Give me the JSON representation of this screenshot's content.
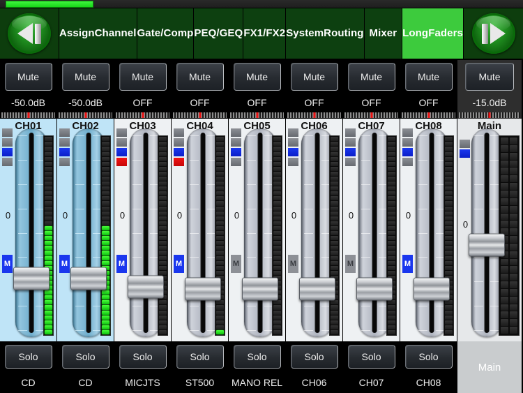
{
  "statusbar": {
    "led_color": "#2ee82e"
  },
  "header": {
    "prev_button": {
      "name": "previous-page",
      "icon": "prev-arrow-icon"
    },
    "next_button": {
      "name": "next-page",
      "icon": "next-arrow-icon"
    },
    "tabs": [
      {
        "label": "Assign\nChannel",
        "active": false
      },
      {
        "label": "Gate/Comp",
        "active": false
      },
      {
        "label": "PEQ/GEQ",
        "active": false
      },
      {
        "label": "FX1/FX2",
        "active": false
      },
      {
        "label": "System\nRouting",
        "active": false
      },
      {
        "label": "Mixer",
        "active": false
      },
      {
        "label": "Long\nFaders",
        "active": true
      }
    ],
    "active_tab_color": "#3dcb3d",
    "tab_color": "#0d4010"
  },
  "channels": [
    {
      "id": "CH01",
      "name": "CH01",
      "mute_label": "Mute",
      "level": "-50.0dB",
      "solo_label": "Solo",
      "bottom_label": "CD",
      "selected": true,
      "indicators": [
        "grey",
        "grey",
        "blue",
        "grey"
      ],
      "m_active": true,
      "zero_label": "0",
      "m_label": "M",
      "fader_pct": 72,
      "meter_segments": 40,
      "meter_lit": 22,
      "meter_gap_bottom": 0
    },
    {
      "id": "CH02",
      "name": "CH02",
      "mute_label": "Mute",
      "level": "-50.0dB",
      "solo_label": "Solo",
      "bottom_label": "CD",
      "selected": true,
      "indicators": [
        "grey",
        "grey",
        "blue",
        "grey"
      ],
      "m_active": true,
      "zero_label": "0",
      "m_label": "M",
      "fader_pct": 72,
      "meter_segments": 40,
      "meter_lit": 22,
      "meter_gap_bottom": 0
    },
    {
      "id": "CH03",
      "name": "CH03",
      "mute_label": "Mute",
      "level": "OFF",
      "solo_label": "Solo",
      "bottom_label": "MICJTS",
      "selected": false,
      "indicators": [
        "grey",
        "grey",
        "blue",
        "red"
      ],
      "m_active": true,
      "zero_label": "0",
      "m_label": "M",
      "fader_pct": 76,
      "meter_segments": 40,
      "meter_lit": 0,
      "meter_gap_bottom": 0
    },
    {
      "id": "CH04",
      "name": "CH04",
      "mute_label": "Mute",
      "level": "OFF",
      "solo_label": "Solo",
      "bottom_label": "ST500",
      "selected": false,
      "indicators": [
        "grey",
        "grey",
        "blue",
        "red"
      ],
      "m_active": true,
      "zero_label": "0",
      "m_label": "M",
      "fader_pct": 77,
      "meter_segments": 40,
      "meter_lit": 1,
      "meter_gap_bottom": 0
    },
    {
      "id": "CH05",
      "name": "CH05",
      "mute_label": "Mute",
      "level": "OFF",
      "solo_label": "Solo",
      "bottom_label": "MANO REL",
      "selected": false,
      "indicators": [
        "grey",
        "grey",
        "blue",
        "grey"
      ],
      "m_active": false,
      "zero_label": "0",
      "m_label": "M",
      "fader_pct": 77,
      "meter_segments": 40,
      "meter_lit": 0,
      "meter_gap_bottom": 0
    },
    {
      "id": "CH06",
      "name": "CH06",
      "mute_label": "Mute",
      "level": "OFF",
      "solo_label": "Solo",
      "bottom_label": "CH06",
      "selected": false,
      "indicators": [
        "grey",
        "grey",
        "blue",
        "grey"
      ],
      "m_active": false,
      "zero_label": "0",
      "m_label": "M",
      "fader_pct": 77,
      "meter_segments": 40,
      "meter_lit": 0,
      "meter_gap_bottom": 0
    },
    {
      "id": "CH07",
      "name": "CH07",
      "mute_label": "Mute",
      "level": "OFF",
      "solo_label": "Solo",
      "bottom_label": "CH07",
      "selected": false,
      "indicators": [
        "grey",
        "grey",
        "blue",
        "grey"
      ],
      "m_active": false,
      "zero_label": "0",
      "m_label": "M",
      "fader_pct": 77,
      "meter_segments": 40,
      "meter_lit": 0,
      "meter_gap_bottom": 0
    },
    {
      "id": "CH08",
      "name": "CH08",
      "mute_label": "Mute",
      "level": "OFF",
      "solo_label": "Solo",
      "bottom_label": "CH08",
      "selected": false,
      "indicators": [
        "grey",
        "grey",
        "blue",
        "grey"
      ],
      "m_active": true,
      "zero_label": "0",
      "m_label": "M",
      "fader_pct": 77,
      "meter_segments": 40,
      "meter_lit": 0,
      "meter_gap_bottom": 0
    }
  ],
  "main_channel": {
    "id": "Main",
    "name": "Main",
    "mute_label": "Mute",
    "level": "-15.0dB",
    "bottom_label": "Main",
    "indicators": [
      "grey",
      "blue"
    ],
    "zero_label": "0",
    "fader_pct": 56,
    "meter_segments": 26,
    "meter_lit": 0,
    "stereo": true
  }
}
